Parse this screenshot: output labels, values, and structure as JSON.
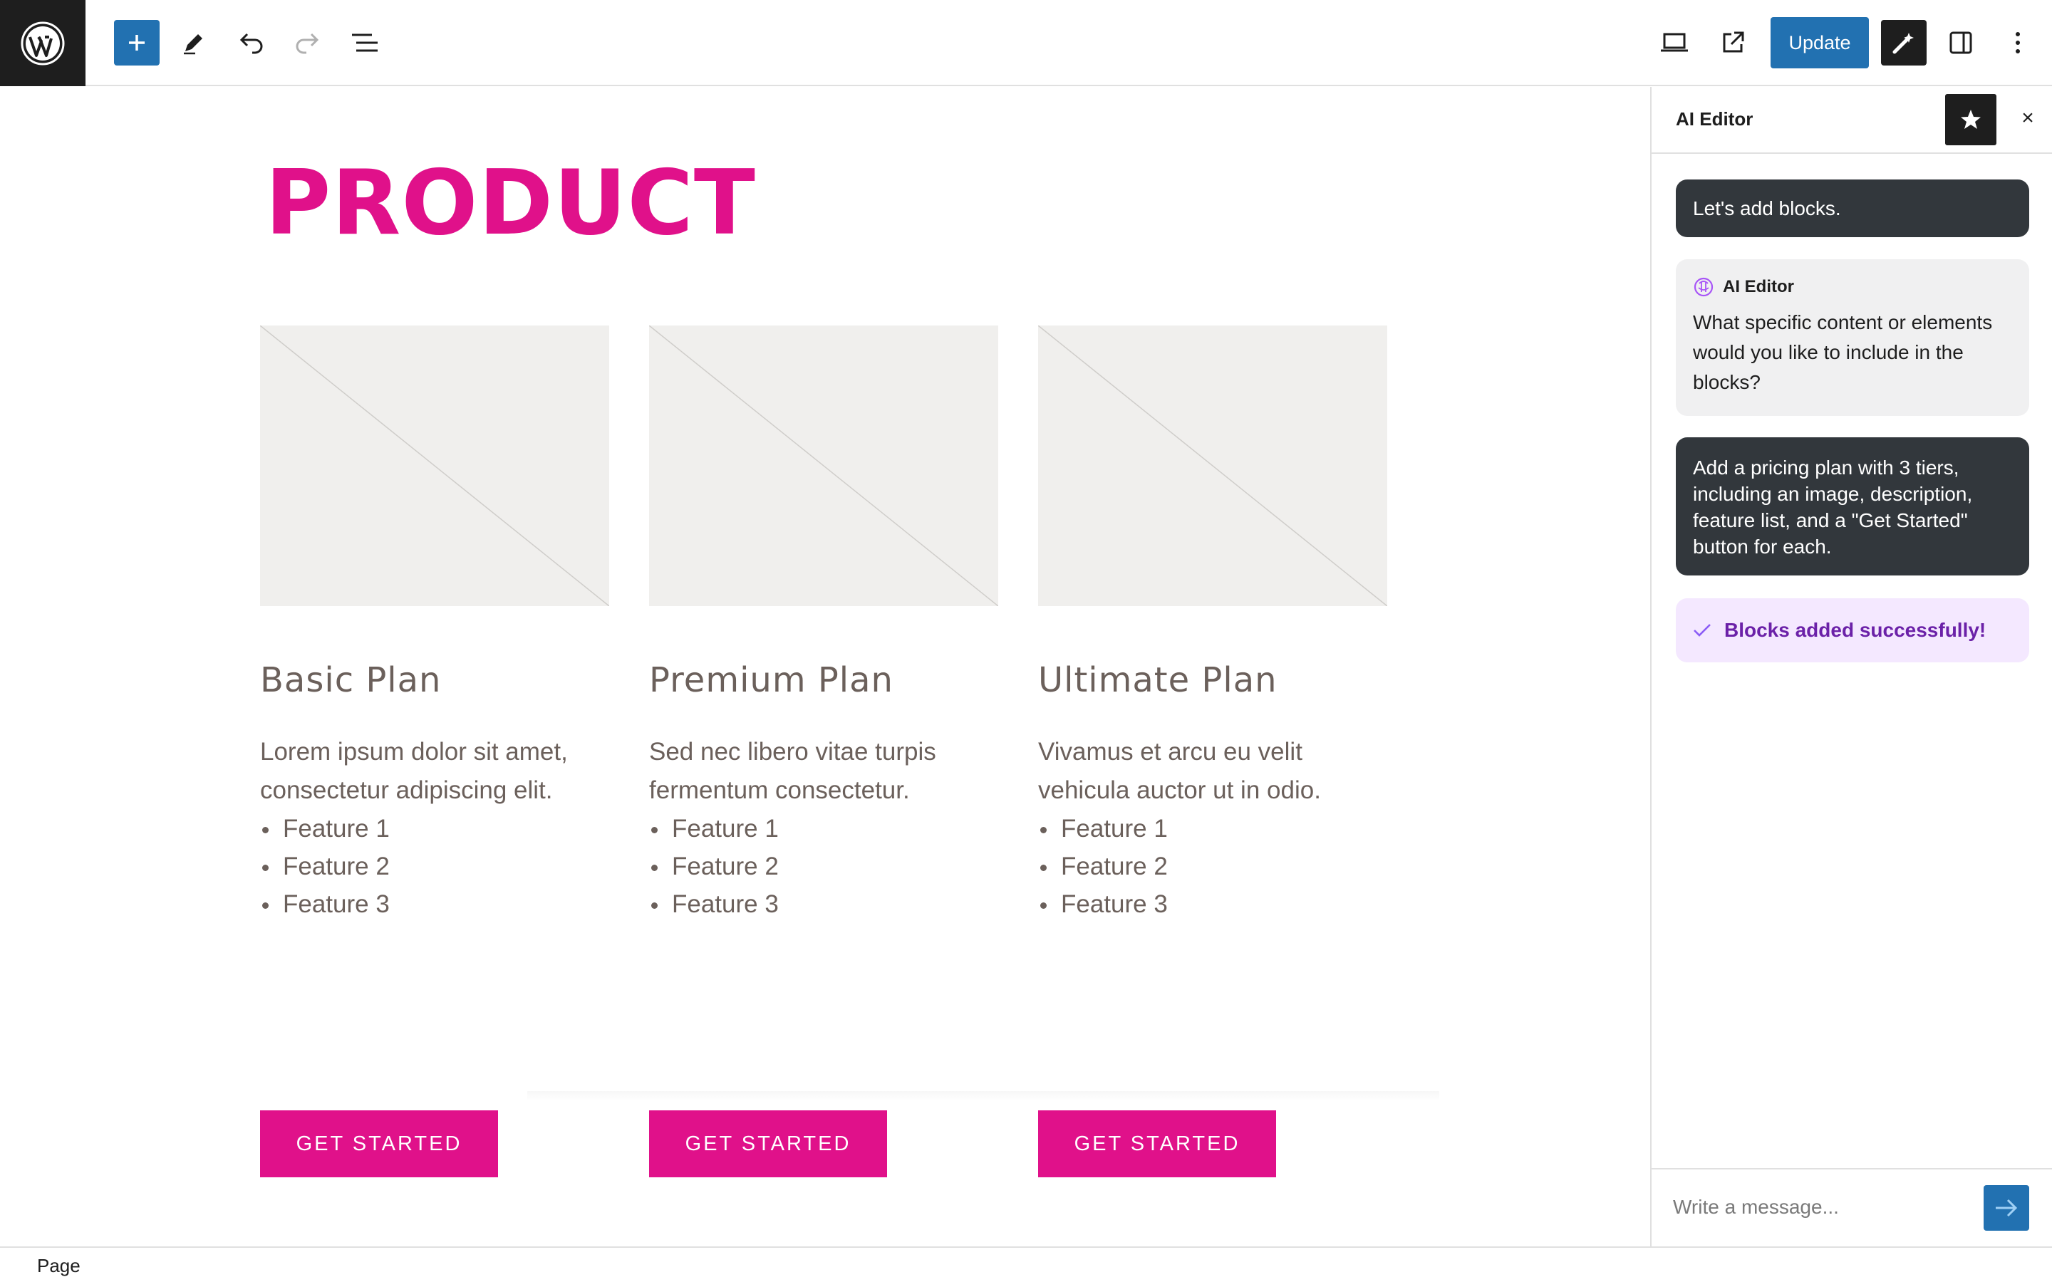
{
  "toolbar": {
    "update_label": "Update"
  },
  "canvas": {
    "page_title": "PRODUCT",
    "plans": [
      {
        "title": "Basic Plan",
        "description": "Lorem ipsum dolor sit amet, consectetur adipiscing elit.",
        "features": [
          "Feature 1",
          "Feature 2",
          "Feature 3"
        ],
        "cta": "GET STARTED"
      },
      {
        "title": "Premium Plan",
        "description": "Sed nec libero vitae turpis fermentum consectetur.",
        "features": [
          "Feature 1",
          "Feature 2",
          "Feature 3"
        ],
        "cta": "GET STARTED"
      },
      {
        "title": "Ultimate Plan",
        "description": "Vivamus et arcu eu velit vehicula auctor ut in odio.",
        "features": [
          "Feature 1",
          "Feature 2",
          "Feature 3"
        ],
        "cta": "GET STARTED"
      }
    ]
  },
  "sidebar": {
    "title": "AI Editor",
    "close_label": "×",
    "messages": [
      {
        "role": "user",
        "text": "Let's add blocks."
      },
      {
        "role": "assistant",
        "author": "AI Editor",
        "text": "What specific content or elements would you like to include in the blocks?"
      },
      {
        "role": "user",
        "text": "Add a pricing plan with 3 tiers, including an image, description, feature list, and a \"Get Started\" button for each."
      },
      {
        "role": "status",
        "text": "Blocks added successfully!"
      }
    ],
    "composer": {
      "placeholder": "Write a message..."
    }
  },
  "footer": {
    "breadcrumb": "Page"
  },
  "colors": {
    "accent": "#e0118a",
    "primary": "#2271b1",
    "text_muted": "#6b605b",
    "dark": "#1e1e1e",
    "success_bg": "#f4e8ff",
    "success_text": "#6b21a8"
  },
  "icons": [
    "wordpress-logo-icon",
    "plus-icon",
    "pencil-icon",
    "undo-icon",
    "redo-icon",
    "list-view-icon",
    "desktop-preview-icon",
    "external-link-icon",
    "ai-wand-icon",
    "sidebar-toggle-icon",
    "more-vertical-icon",
    "star-icon",
    "close-icon",
    "ai-brain-icon",
    "check-icon",
    "send-arrow-icon"
  ]
}
